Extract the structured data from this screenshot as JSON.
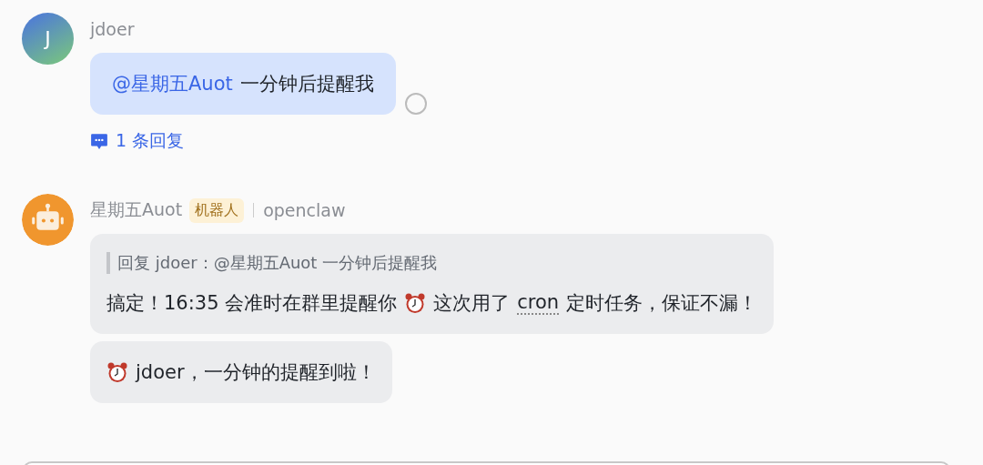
{
  "messages": [
    {
      "kind": "user",
      "avatar": "J",
      "sender": "jdoer",
      "bubbles": [
        {
          "segments": [
            {
              "kind": "mention",
              "text": "@星期五Auot"
            },
            {
              "kind": "text",
              "text": "一分钟后提醒我"
            }
          ]
        }
      ],
      "read_receipt": true,
      "reply_count": "1 条回复"
    },
    {
      "kind": "bot",
      "sender": "星期五Auot",
      "badge": "机器人",
      "source": "openclaw",
      "bubbles": [
        {
          "quote": "回复 jdoer：@星期五Auot 一分钟后提醒我",
          "segments": [
            {
              "kind": "text",
              "text": "搞定！16:35 会准时在群里提醒你"
            },
            {
              "kind": "alarm"
            },
            {
              "kind": "text",
              "text": "这次用了"
            },
            {
              "kind": "term",
              "text": "cron"
            },
            {
              "kind": "text",
              "text": "定时任务，保证不漏！"
            }
          ]
        },
        {
          "segments": [
            {
              "kind": "alarm"
            },
            {
              "kind": "text",
              "text": "jdoer，一分钟的提醒到啦！"
            }
          ]
        }
      ]
    }
  ]
}
